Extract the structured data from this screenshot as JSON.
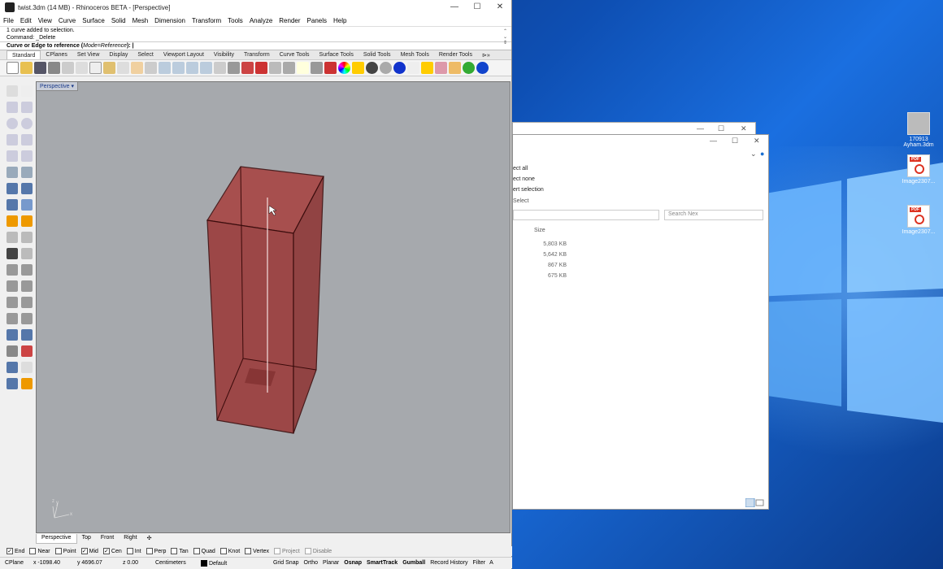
{
  "window": {
    "title": "twist.3dm (14 MB) - Rhinoceros BETA - [Perspective]",
    "minimize": "—",
    "maximize": "☐",
    "close": "✕"
  },
  "menu": [
    "File",
    "Edit",
    "View",
    "Curve",
    "Surface",
    "Solid",
    "Mesh",
    "Dimension",
    "Transform",
    "Tools",
    "Analyze",
    "Render",
    "Panels",
    "Help"
  ],
  "command": {
    "history": [
      "1 curve added to selection.",
      "Command: _Delete"
    ],
    "prompt": "Curve or Edge to reference (",
    "option": "Mode=Reference",
    "prompt_end": "):"
  },
  "toolbar_tabs": [
    "Standard",
    "CPlanes",
    "Set View",
    "Display",
    "Select",
    "Viewport Layout",
    "Visibility",
    "Transform",
    "Curve Tools",
    "Surface Tools",
    "Solid Tools",
    "Mesh Tools",
    "Render Tools",
    "⊳»"
  ],
  "viewport": {
    "label": "Perspective",
    "axis_z": "z",
    "axis_y": "y",
    "axis_x": "x"
  },
  "viewport_tabs": [
    "Perspective",
    "Top",
    "Front",
    "Right",
    "✣"
  ],
  "osnaps": [
    {
      "label": "End",
      "checked": true
    },
    {
      "label": "Near",
      "checked": false
    },
    {
      "label": "Point",
      "checked": false
    },
    {
      "label": "Mid",
      "checked": true
    },
    {
      "label": "Cen",
      "checked": true
    },
    {
      "label": "Int",
      "checked": false
    },
    {
      "label": "Perp",
      "checked": false
    },
    {
      "label": "Tan",
      "checked": false
    },
    {
      "label": "Quad",
      "checked": false
    },
    {
      "label": "Knot",
      "checked": false
    },
    {
      "label": "Vertex",
      "checked": false
    },
    {
      "label": "Project",
      "checked": false,
      "disabled": true
    },
    {
      "label": "Disable",
      "checked": false,
      "disabled": true
    }
  ],
  "status": {
    "cplane": "CPlane",
    "x": "x -1098.40",
    "y": "y 4696.07",
    "z": "z 0.00",
    "units": "Centimeters",
    "layer": "Default",
    "toggles": [
      "Grid Snap",
      "Ortho",
      "Planar",
      "Osnap",
      "SmartTrack",
      "Gumball",
      "Record History",
      "Filter"
    ],
    "bold_toggles": [
      "Osnap",
      "SmartTrack",
      "Gumball"
    ],
    "trail": "A"
  },
  "explorer": {
    "ribbon": [
      "ect all",
      "ect none",
      "ert selection",
      "Select"
    ],
    "search_placeholder": "Search Nex",
    "col_size": "Size",
    "sizes": [
      "5,803 KB",
      "5,642 KB",
      "867 KB",
      "675 KB"
    ]
  },
  "desktop_icons": [
    {
      "label": "170913 Ayham.3dm",
      "type": "3dm"
    },
    {
      "label": "Image2307...",
      "type": "pdf"
    },
    {
      "label": "Image2307...",
      "type": "pdf"
    }
  ],
  "pdf_badge": "PDF",
  "colors": {
    "box_fill": "#9b3a3a",
    "viewport_bg": "#a6a9ad",
    "desktop_blue": "#0e4fb3"
  }
}
